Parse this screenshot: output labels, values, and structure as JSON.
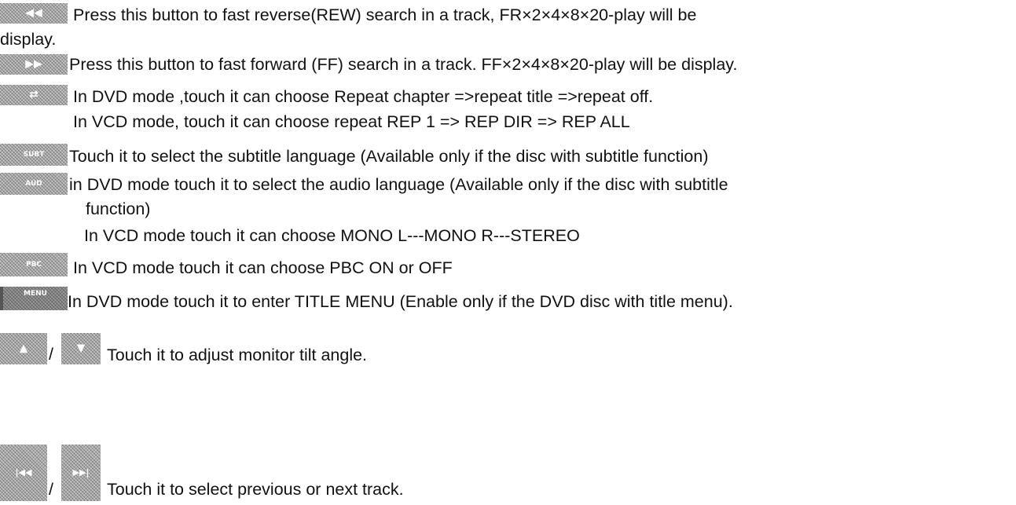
{
  "items": [
    {
      "icon_name": "rewind-button-icon",
      "icon_symbol": "◀◀",
      "lines": [
        "Press this button to fast reverse(REW) search in a track, FR×2×4×8×20-play will be",
        "display."
      ]
    },
    {
      "icon_name": "fast-forward-button-icon",
      "icon_symbol": "▶▶",
      "lines": [
        "Press this button to fast forward (FF) search in a track. FF×2×4×8×20-play will be display."
      ]
    },
    {
      "icon_name": "repeat-button-icon",
      "icon_symbol": "⇄",
      "lines": [
        "In DVD mode ,touch it can choose Repeat chapter =>repeat title =>repeat off.",
        "In VCD mode, touch it can choose repeat REP 1  => REP DIR  => REP ALL"
      ]
    },
    {
      "icon_name": "subtitle-button-icon",
      "icon_label": "SUBT",
      "lines": [
        "Touch it to select the subtitle language (Available only if the disc with subtitle function)"
      ]
    },
    {
      "icon_name": "audio-button-icon",
      "icon_label": "AUD",
      "lines": [
        "in DVD mode touch it to select the audio language (Available only if the disc with subtitle",
        "function)",
        "In VCD mode touch it can choose MONO L---MONO R---STEREO"
      ]
    },
    {
      "icon_name": "pbc-button-icon",
      "icon_label": "PBC",
      "lines": [
        "In VCD mode touch it can choose PBC ON or OFF"
      ]
    },
    {
      "icon_name": "menu-button-icon",
      "icon_label": "MENU",
      "lines": [
        "In DVD mode touch it to enter TITLE MENU (Enable only if the DVD disc with title menu)."
      ]
    },
    {
      "icon_names": [
        "tilt-up-button-icon",
        "tilt-down-button-icon"
      ],
      "icon_symbols": [
        "▲",
        "▼"
      ],
      "separator": "/",
      "lines": [
        "Touch it to adjust monitor tilt angle."
      ]
    },
    {
      "icon_names": [
        "previous-track-button-icon",
        "next-track-button-icon"
      ],
      "icon_symbols": [
        "|◀◀",
        "▶▶|"
      ],
      "separator": "/",
      "lines": [
        "Touch it to select previous or next track."
      ]
    }
  ]
}
